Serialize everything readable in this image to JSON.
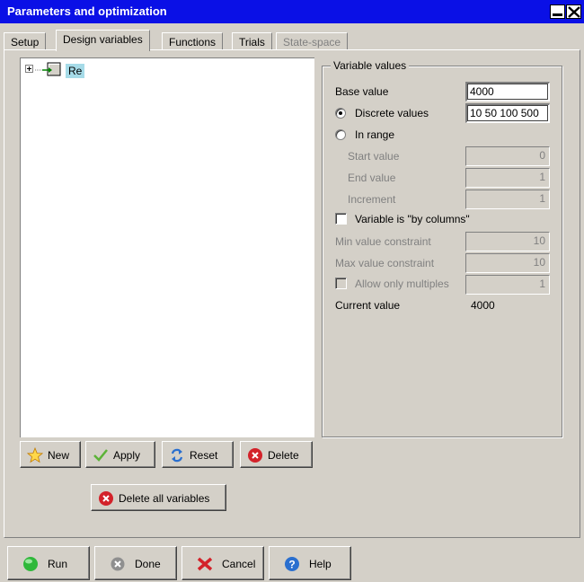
{
  "window": {
    "title": "Parameters and optimization"
  },
  "tabs": [
    {
      "label": "Setup"
    },
    {
      "label": "Design variables"
    },
    {
      "label": "Functions"
    },
    {
      "label": "Trials"
    },
    {
      "label": "State-space"
    }
  ],
  "tree": {
    "items": [
      {
        "label": "Re"
      }
    ]
  },
  "variable_values": {
    "group_title": "Variable values",
    "base_value_label": "Base value",
    "base_value": "4000",
    "discrete_label": "Discrete values",
    "discrete_value": "10 50 100 500",
    "in_range_label": "In range",
    "start_label": "Start value",
    "start_value": "0",
    "end_label": "End value",
    "end_value": "1",
    "increment_label": "Increment",
    "increment_value": "1",
    "by_columns_label": "Variable is \"by columns\"",
    "min_constraint_label": "Min value constraint",
    "min_constraint_value": "10",
    "max_constraint_label": "Max value constraint",
    "max_constraint_value": "10",
    "multiples_label": "Allow only multiples",
    "multiples_value": "1",
    "current_label": "Current value",
    "current_value": "4000"
  },
  "actions": {
    "new": "New",
    "apply": "Apply",
    "reset": "Reset",
    "delete": "Delete",
    "delete_all": "Delete all variables"
  },
  "footer": {
    "run": "Run",
    "done": "Done",
    "cancel": "Cancel",
    "help": "Help"
  },
  "colors": {
    "titlebar": "#0a10e6",
    "selection": "#a6dbe8",
    "face": "#d4d0c8"
  }
}
